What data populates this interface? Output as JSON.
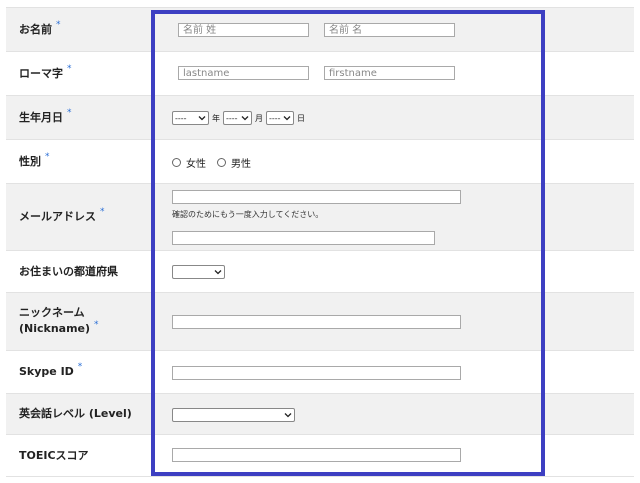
{
  "required_mark": "*",
  "fields": {
    "name": {
      "label": "お名前",
      "last_placeholder": "名前 姓",
      "first_placeholder": "名前 名"
    },
    "roman": {
      "label": "ローマ字",
      "last_placeholder": "lastname",
      "first_placeholder": "firstname"
    },
    "birth": {
      "label": "生年月日",
      "year_value": "----",
      "year_unit": "年",
      "month_value": "----",
      "month_unit": "月",
      "day_value": "----",
      "day_unit": "日"
    },
    "gender": {
      "label": "性別",
      "option_female": "女性",
      "option_male": "男性"
    },
    "email": {
      "label": "メールアドレス",
      "value": "",
      "confirm_note": "確認のためにもう一度入力してください。",
      "confirm_value": ""
    },
    "prefecture": {
      "label": "お住まいの都道府県",
      "value": ""
    },
    "nickname": {
      "label_line1": "ニックネーム",
      "label_line2": "(Nickname)",
      "value": ""
    },
    "skype": {
      "label": "Skype ID",
      "value": ""
    },
    "level": {
      "label": "英会話レベル (Level)",
      "value": ""
    },
    "toeic": {
      "label": "TOEICスコア",
      "value": ""
    }
  },
  "colors": {
    "highlight": "#3d3fc2",
    "required": "#2b6fd6",
    "row_alt": "#f1f1f1"
  }
}
